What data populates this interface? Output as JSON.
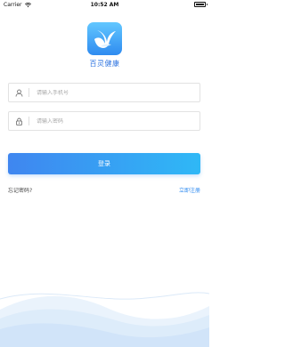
{
  "status_bar": {
    "carrier": "Carrier",
    "time": "10:52 AM"
  },
  "app": {
    "name": "百灵健康",
    "icon": "bird-logo-icon"
  },
  "form": {
    "phone": {
      "value": "",
      "placeholder": "请输入手机号",
      "icon": "user-icon"
    },
    "password": {
      "value": "",
      "placeholder": "请输入密码",
      "icon": "lock-icon"
    },
    "login_label": "登录",
    "forgot_label": "忘记密码?",
    "register_label": "立即注册"
  },
  "colors": {
    "accent": "#2f8bf0",
    "button_start": "#3f86f0",
    "button_end": "#2fb8f6"
  }
}
